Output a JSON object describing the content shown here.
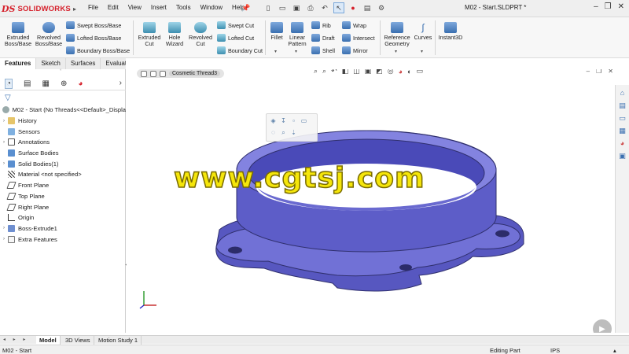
{
  "app": {
    "logo_text": "SOLIDWORKS",
    "document_title": "M02 - Start.SLDPRT *"
  },
  "menu": [
    "File",
    "Edit",
    "View",
    "Insert",
    "Tools",
    "Window",
    "Help"
  ],
  "command_manager": {
    "extruded_boss": "Extruded Boss/Base",
    "revolved_boss": "Revolved Boss/Base",
    "swept_boss": "Swept Boss/Base",
    "lofted_boss": "Lofted Boss/Base",
    "boundary_boss": "Boundary Boss/Base",
    "extruded_cut": "Extruded Cut",
    "hole_wizard": "Hole Wizard",
    "revolved_cut": "Revolved Cut",
    "swept_cut": "Swept Cut",
    "lofted_cut": "Lofted Cut",
    "boundary_cut": "Boundary Cut",
    "fillet": "Fillet",
    "linear_pattern": "Linear Pattern",
    "rib": "Rib",
    "draft": "Draft",
    "shell": "Shell",
    "wrap": "Wrap",
    "intersect": "Intersect",
    "mirror": "Mirror",
    "reference_geometry": "Reference Geometry",
    "curves": "Curves",
    "instant3d": "Instant3D"
  },
  "command_tabs": [
    "Features",
    "Sketch",
    "Surfaces",
    "Evaluate"
  ],
  "tree": {
    "root": "M02 - Start  (No Threads<<Default>_Displa",
    "items": [
      {
        "label": "History",
        "expandable": true
      },
      {
        "label": "Sensors",
        "expandable": false
      },
      {
        "label": "Annotations",
        "expandable": true
      },
      {
        "label": "Surface Bodies",
        "expandable": false
      },
      {
        "label": "Solid Bodies(1)",
        "expandable": true
      },
      {
        "label": "Material <not specified>",
        "expandable": false
      },
      {
        "label": "Front Plane",
        "expandable": false
      },
      {
        "label": "Top Plane",
        "expandable": false
      },
      {
        "label": "Right Plane",
        "expandable": false
      },
      {
        "label": "Origin",
        "expandable": false
      },
      {
        "label": "Boss-Extrude1",
        "expandable": true
      },
      {
        "label": "Extra Features",
        "expandable": true
      }
    ]
  },
  "viewport": {
    "breadcrumb": "Cosmetic Thread3",
    "watermark": "www.cgtsj.com"
  },
  "bottom_tabs": [
    "Model",
    "3D Views",
    "Motion Study 1"
  ],
  "status": {
    "left": "M02 - Start",
    "mode": "Editing Part",
    "units": "IPS"
  },
  "colors": {
    "brand_red": "#d6202b",
    "part_blue": "#6f6fd6",
    "watermark_yellow": "#f5e60a",
    "accent_blue": "#3a6fb0"
  }
}
